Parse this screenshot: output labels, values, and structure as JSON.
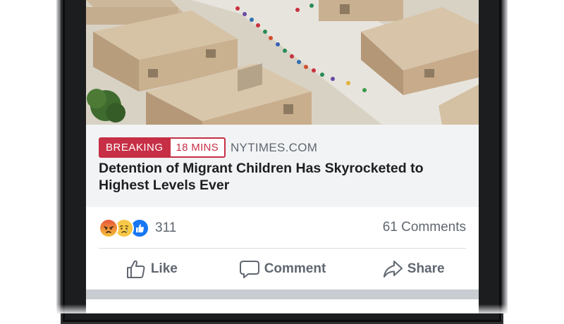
{
  "post": {
    "photo_alt": "Aerial view of tents with children walking in line",
    "tags": {
      "breaking": "BREAKING",
      "time": "18 MINS"
    },
    "source": "NYTIMES.COM",
    "headline": "Detention of Migrant Children Has Skyrocketed to Highest Levels Ever"
  },
  "engagement": {
    "reactions": [
      "angry-icon",
      "sad-icon",
      "like-icon"
    ],
    "reaction_count": "311",
    "comments": "61 Comments"
  },
  "actions": [
    {
      "label": "Like",
      "icon": "thumbs-up-icon"
    },
    {
      "label": "Comment",
      "icon": "speech-bubble-icon"
    },
    {
      "label": "Share",
      "icon": "share-arrow-icon"
    }
  ],
  "colors": {
    "breaking": "#c62f45",
    "text_primary": "#1c1e21",
    "text_secondary": "#606770",
    "link_bg": "#f2f3f5",
    "like_blue": "#1877f2"
  }
}
